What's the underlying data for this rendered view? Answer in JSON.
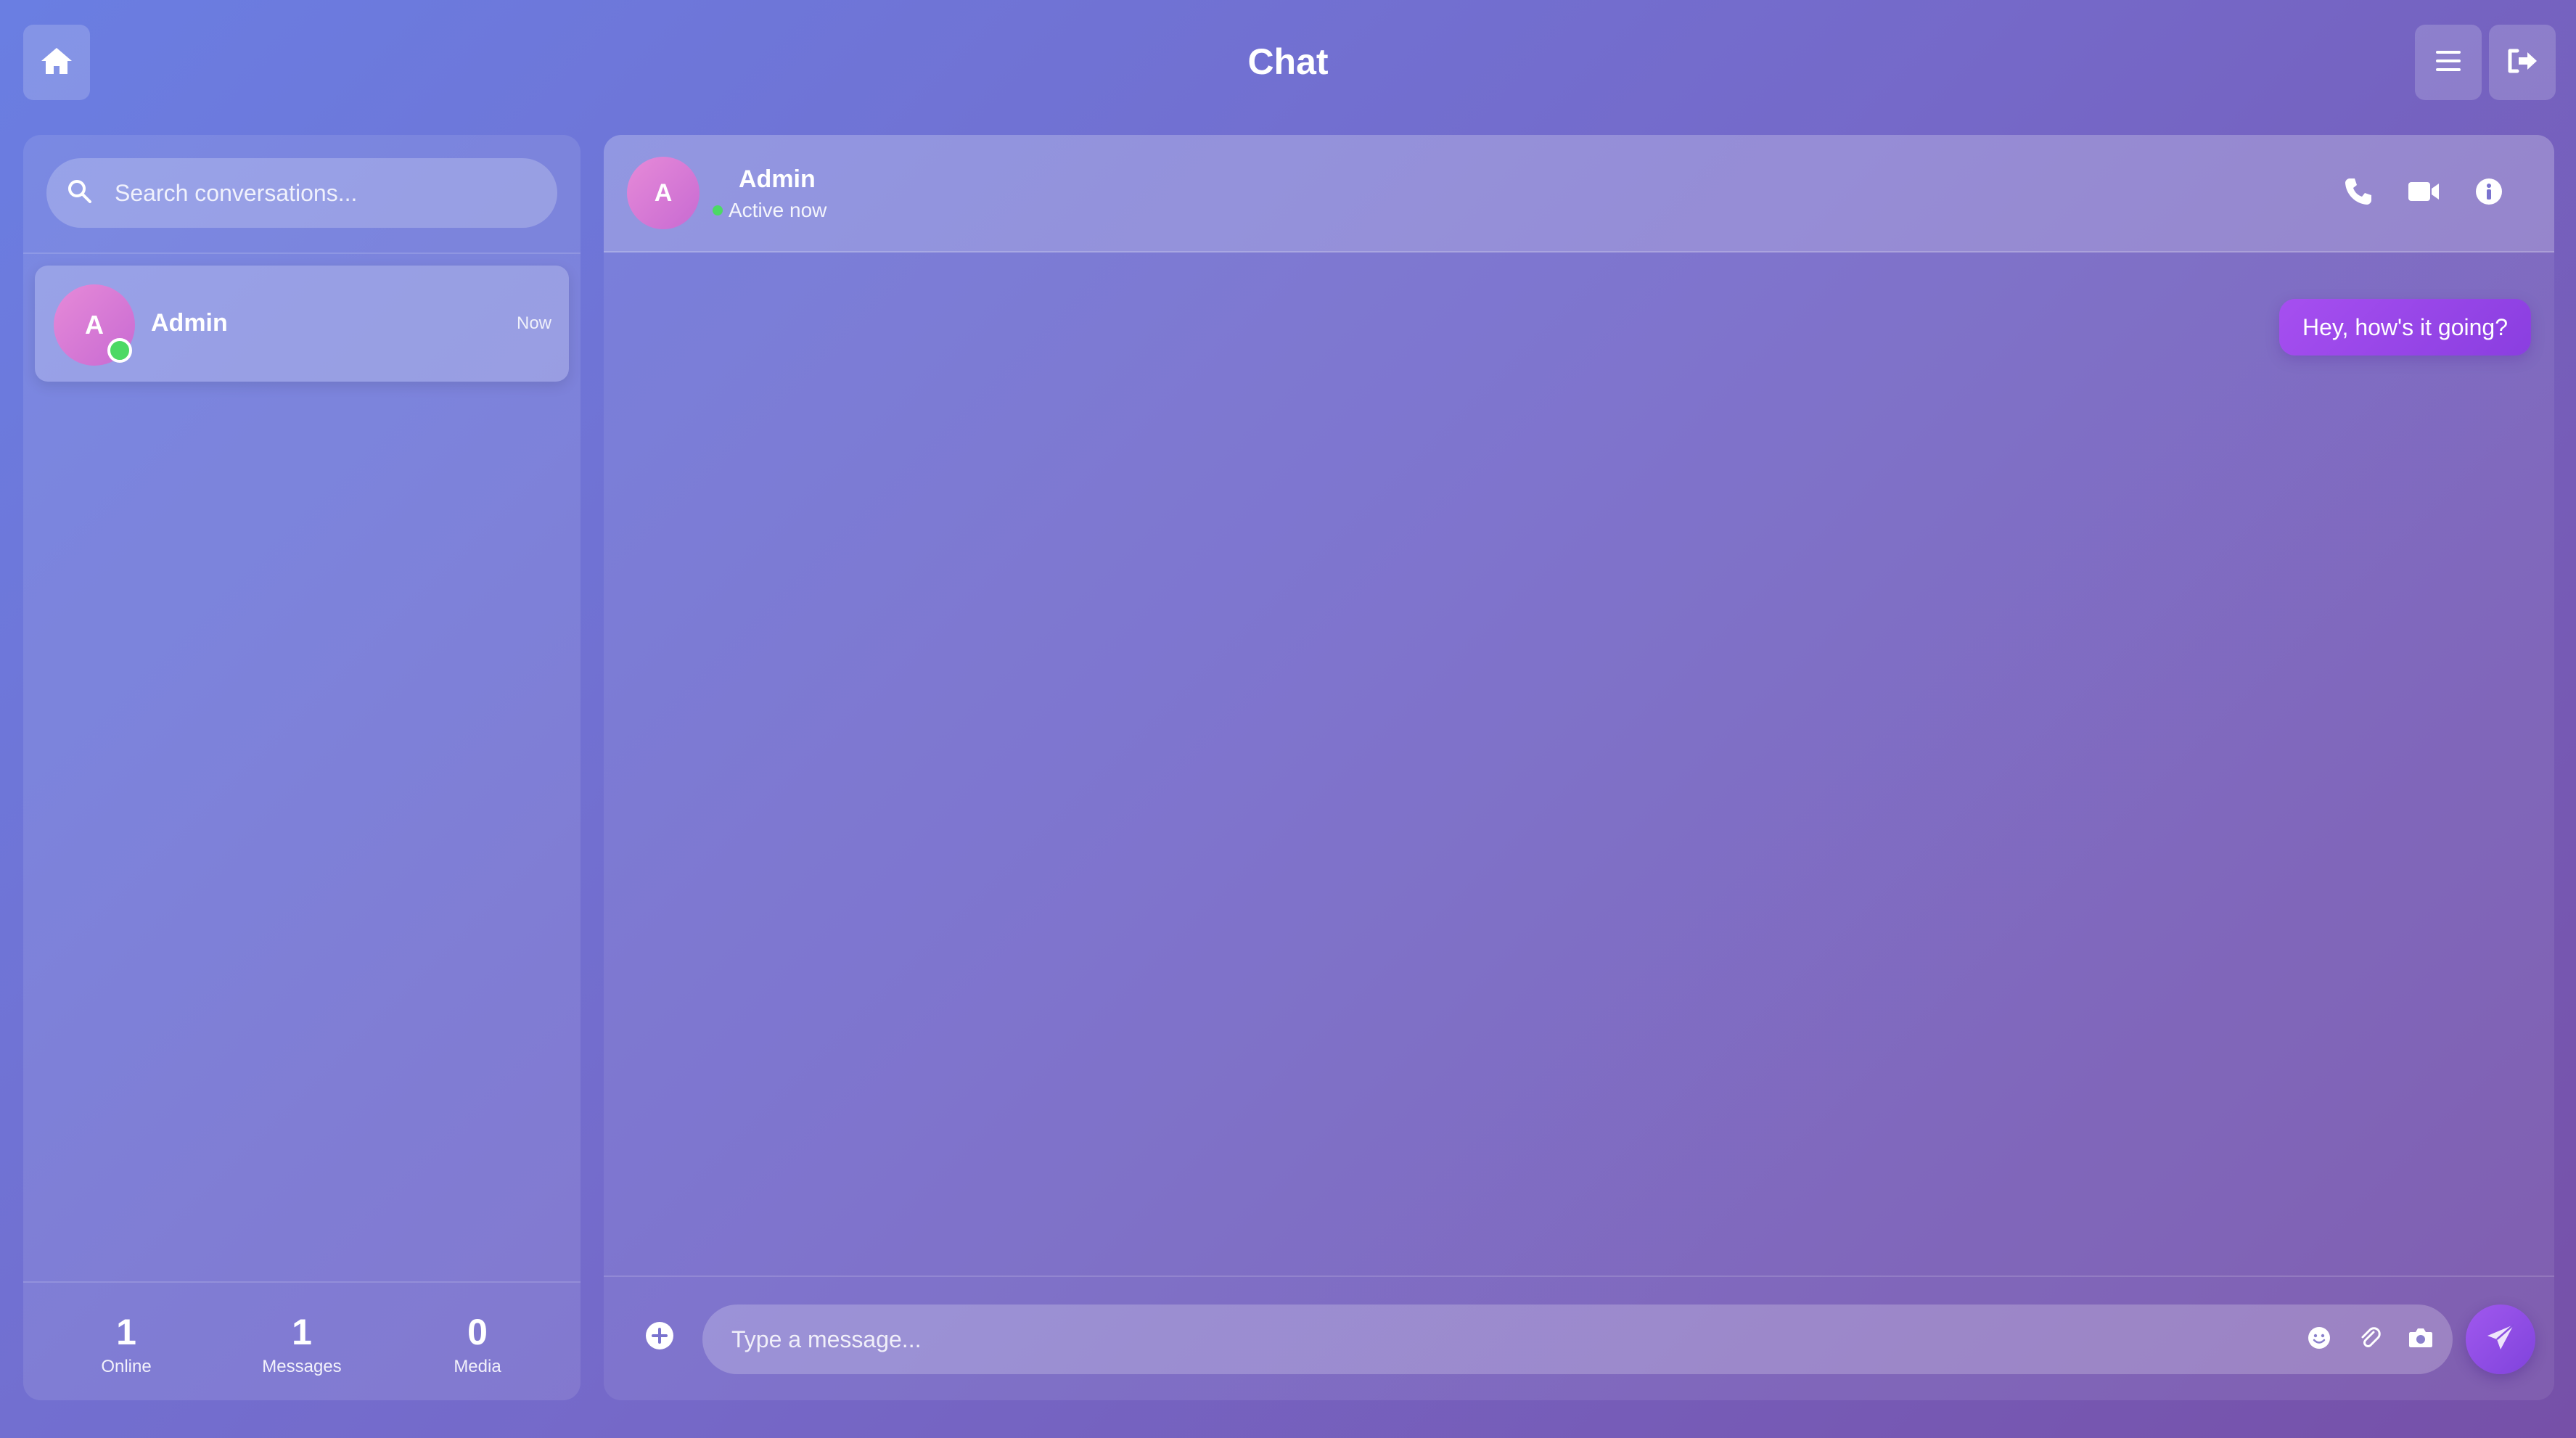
{
  "header": {
    "title": "Chat",
    "home_icon": "home-icon",
    "menu_icon": "hamburger-menu-icon",
    "logout_icon": "logout-icon"
  },
  "sidebar": {
    "search": {
      "placeholder": "Search conversations...",
      "value": ""
    },
    "conversations": [
      {
        "avatar_initial": "A",
        "name": "Admin",
        "time": "Now",
        "online": true
      }
    ],
    "stats": [
      {
        "value": "1",
        "label": "Online"
      },
      {
        "value": "1",
        "label": "Messages"
      },
      {
        "value": "0",
        "label": "Media"
      }
    ]
  },
  "chat": {
    "contact": {
      "avatar_initial": "A",
      "name": "Admin",
      "status": "Active now"
    },
    "actions": [
      "phone-icon",
      "video-icon",
      "info-icon"
    ],
    "messages": [
      {
        "text": "Hey, how's it going?",
        "outgoing": true
      }
    ],
    "composer": {
      "placeholder": "Type a message...",
      "value": ""
    }
  },
  "colors": {
    "bg_start": "#6a7ee2",
    "bg_end": "#7650a8",
    "accent": "#9a4ce8",
    "online": "#4cd964",
    "avatar": "#d87ad5"
  }
}
